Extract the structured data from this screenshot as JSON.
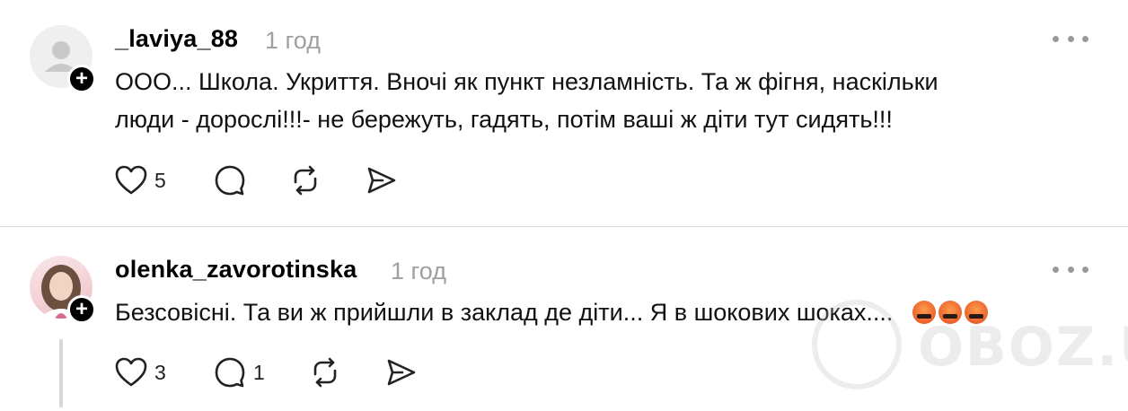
{
  "comments": [
    {
      "username": "_laviya_88",
      "time": "1 год",
      "text_line1": "ООО... Школа. Укриття. Вночі як пункт незламність. Та ж фігня, наскільки",
      "text_line2": "люди - дорослі!!!- не бережуть, гадять, потім ваші ж діти тут сидять!!!",
      "likes": "5",
      "replies": "",
      "avatar": "default-avatar",
      "badge": "+"
    },
    {
      "username": "olenka_zavorotinska",
      "time": "1 год",
      "text": "Безсовісні. Та ви ж прийшли в заклад де діти... Я в шокових шоках....",
      "likes": "3",
      "replies": "1",
      "avatar": "photo-avatar",
      "badge": "+"
    }
  ],
  "icons": {
    "like": "heart-icon",
    "reply": "comment-icon",
    "repost": "repost-icon",
    "share": "send-icon",
    "more": "more-icon"
  },
  "watermark": {
    "text": "OBOZ.UA"
  }
}
